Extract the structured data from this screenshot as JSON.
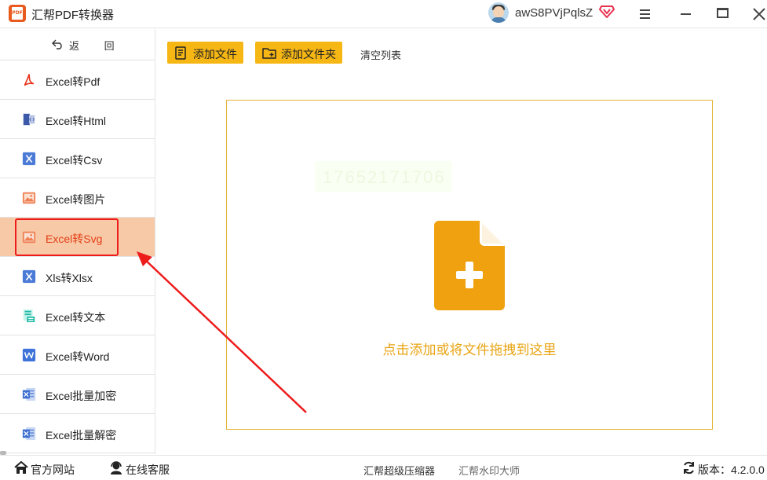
{
  "app": {
    "title": "汇帮PDF转换器",
    "logo_text": "PDF"
  },
  "user": {
    "name": "awS8PVjPqlsZ"
  },
  "sidebar": {
    "back_label": "返 回",
    "items": [
      {
        "label": "Excel转Pdf",
        "icon": "pdf-icon"
      },
      {
        "label": "Excel转Html",
        "icon": "html-icon"
      },
      {
        "label": "Excel转Csv",
        "icon": "csv-icon"
      },
      {
        "label": "Excel转图片",
        "icon": "image-icon"
      },
      {
        "label": "Excel转Svg",
        "icon": "svg-icon",
        "active": true
      },
      {
        "label": "Xls转Xlsx",
        "icon": "xlsx-icon"
      },
      {
        "label": "Excel转文本",
        "icon": "text-icon"
      },
      {
        "label": "Excel转Word",
        "icon": "word-icon"
      },
      {
        "label": "Excel批量加密",
        "icon": "excel-lock-icon"
      },
      {
        "label": "Excel批量解密",
        "icon": "excel-unlock-icon"
      }
    ]
  },
  "toolbar": {
    "add_file": "添加文件",
    "add_folder": "添加文件夹",
    "clear_list": "清空列表"
  },
  "dropzone": {
    "hint": "点击添加或将文件拖拽到这里",
    "watermark": "17652171706"
  },
  "statusbar": {
    "website": "官方网站",
    "support": "在线客服",
    "compressor": "汇帮超级压缩器",
    "watermark_app": "汇帮水印大师",
    "version_label": "版本：4.2.0.0"
  },
  "colors": {
    "accent": "#f6b715",
    "active_bg": "#f7c9a6",
    "active_text": "#e43e18",
    "dropzone_text": "#e9a413",
    "annotation_red": "#ee1b1b"
  }
}
